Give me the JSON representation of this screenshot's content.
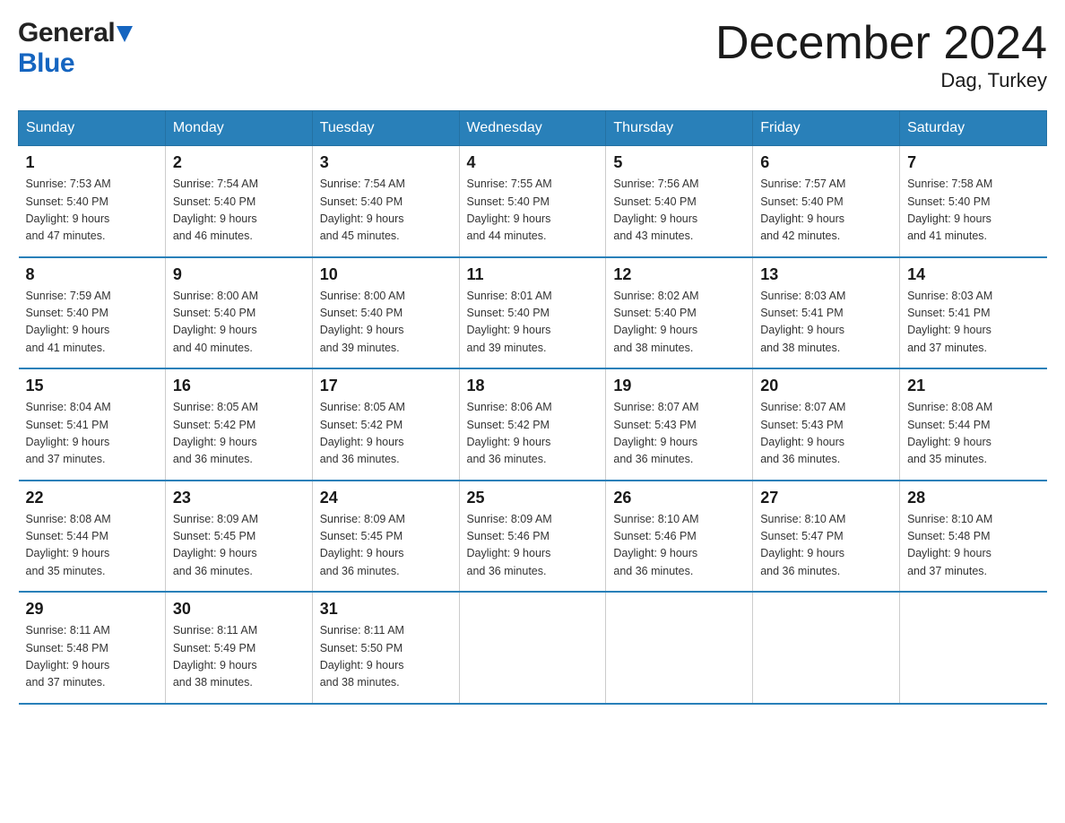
{
  "header": {
    "logo_general": "General",
    "logo_blue": "Blue",
    "month_title": "December 2024",
    "location": "Dag, Turkey"
  },
  "calendar": {
    "days_of_week": [
      "Sunday",
      "Monday",
      "Tuesday",
      "Wednesday",
      "Thursday",
      "Friday",
      "Saturday"
    ],
    "weeks": [
      [
        {
          "day": "1",
          "info": "Sunrise: 7:53 AM\nSunset: 5:40 PM\nDaylight: 9 hours\nand 47 minutes."
        },
        {
          "day": "2",
          "info": "Sunrise: 7:54 AM\nSunset: 5:40 PM\nDaylight: 9 hours\nand 46 minutes."
        },
        {
          "day": "3",
          "info": "Sunrise: 7:54 AM\nSunset: 5:40 PM\nDaylight: 9 hours\nand 45 minutes."
        },
        {
          "day": "4",
          "info": "Sunrise: 7:55 AM\nSunset: 5:40 PM\nDaylight: 9 hours\nand 44 minutes."
        },
        {
          "day": "5",
          "info": "Sunrise: 7:56 AM\nSunset: 5:40 PM\nDaylight: 9 hours\nand 43 minutes."
        },
        {
          "day": "6",
          "info": "Sunrise: 7:57 AM\nSunset: 5:40 PM\nDaylight: 9 hours\nand 42 minutes."
        },
        {
          "day": "7",
          "info": "Sunrise: 7:58 AM\nSunset: 5:40 PM\nDaylight: 9 hours\nand 41 minutes."
        }
      ],
      [
        {
          "day": "8",
          "info": "Sunrise: 7:59 AM\nSunset: 5:40 PM\nDaylight: 9 hours\nand 41 minutes."
        },
        {
          "day": "9",
          "info": "Sunrise: 8:00 AM\nSunset: 5:40 PM\nDaylight: 9 hours\nand 40 minutes."
        },
        {
          "day": "10",
          "info": "Sunrise: 8:00 AM\nSunset: 5:40 PM\nDaylight: 9 hours\nand 39 minutes."
        },
        {
          "day": "11",
          "info": "Sunrise: 8:01 AM\nSunset: 5:40 PM\nDaylight: 9 hours\nand 39 minutes."
        },
        {
          "day": "12",
          "info": "Sunrise: 8:02 AM\nSunset: 5:40 PM\nDaylight: 9 hours\nand 38 minutes."
        },
        {
          "day": "13",
          "info": "Sunrise: 8:03 AM\nSunset: 5:41 PM\nDaylight: 9 hours\nand 38 minutes."
        },
        {
          "day": "14",
          "info": "Sunrise: 8:03 AM\nSunset: 5:41 PM\nDaylight: 9 hours\nand 37 minutes."
        }
      ],
      [
        {
          "day": "15",
          "info": "Sunrise: 8:04 AM\nSunset: 5:41 PM\nDaylight: 9 hours\nand 37 minutes."
        },
        {
          "day": "16",
          "info": "Sunrise: 8:05 AM\nSunset: 5:42 PM\nDaylight: 9 hours\nand 36 minutes."
        },
        {
          "day": "17",
          "info": "Sunrise: 8:05 AM\nSunset: 5:42 PM\nDaylight: 9 hours\nand 36 minutes."
        },
        {
          "day": "18",
          "info": "Sunrise: 8:06 AM\nSunset: 5:42 PM\nDaylight: 9 hours\nand 36 minutes."
        },
        {
          "day": "19",
          "info": "Sunrise: 8:07 AM\nSunset: 5:43 PM\nDaylight: 9 hours\nand 36 minutes."
        },
        {
          "day": "20",
          "info": "Sunrise: 8:07 AM\nSunset: 5:43 PM\nDaylight: 9 hours\nand 36 minutes."
        },
        {
          "day": "21",
          "info": "Sunrise: 8:08 AM\nSunset: 5:44 PM\nDaylight: 9 hours\nand 35 minutes."
        }
      ],
      [
        {
          "day": "22",
          "info": "Sunrise: 8:08 AM\nSunset: 5:44 PM\nDaylight: 9 hours\nand 35 minutes."
        },
        {
          "day": "23",
          "info": "Sunrise: 8:09 AM\nSunset: 5:45 PM\nDaylight: 9 hours\nand 36 minutes."
        },
        {
          "day": "24",
          "info": "Sunrise: 8:09 AM\nSunset: 5:45 PM\nDaylight: 9 hours\nand 36 minutes."
        },
        {
          "day": "25",
          "info": "Sunrise: 8:09 AM\nSunset: 5:46 PM\nDaylight: 9 hours\nand 36 minutes."
        },
        {
          "day": "26",
          "info": "Sunrise: 8:10 AM\nSunset: 5:46 PM\nDaylight: 9 hours\nand 36 minutes."
        },
        {
          "day": "27",
          "info": "Sunrise: 8:10 AM\nSunset: 5:47 PM\nDaylight: 9 hours\nand 36 minutes."
        },
        {
          "day": "28",
          "info": "Sunrise: 8:10 AM\nSunset: 5:48 PM\nDaylight: 9 hours\nand 37 minutes."
        }
      ],
      [
        {
          "day": "29",
          "info": "Sunrise: 8:11 AM\nSunset: 5:48 PM\nDaylight: 9 hours\nand 37 minutes."
        },
        {
          "day": "30",
          "info": "Sunrise: 8:11 AM\nSunset: 5:49 PM\nDaylight: 9 hours\nand 38 minutes."
        },
        {
          "day": "31",
          "info": "Sunrise: 8:11 AM\nSunset: 5:50 PM\nDaylight: 9 hours\nand 38 minutes."
        },
        {
          "day": "",
          "info": ""
        },
        {
          "day": "",
          "info": ""
        },
        {
          "day": "",
          "info": ""
        },
        {
          "day": "",
          "info": ""
        }
      ]
    ]
  }
}
